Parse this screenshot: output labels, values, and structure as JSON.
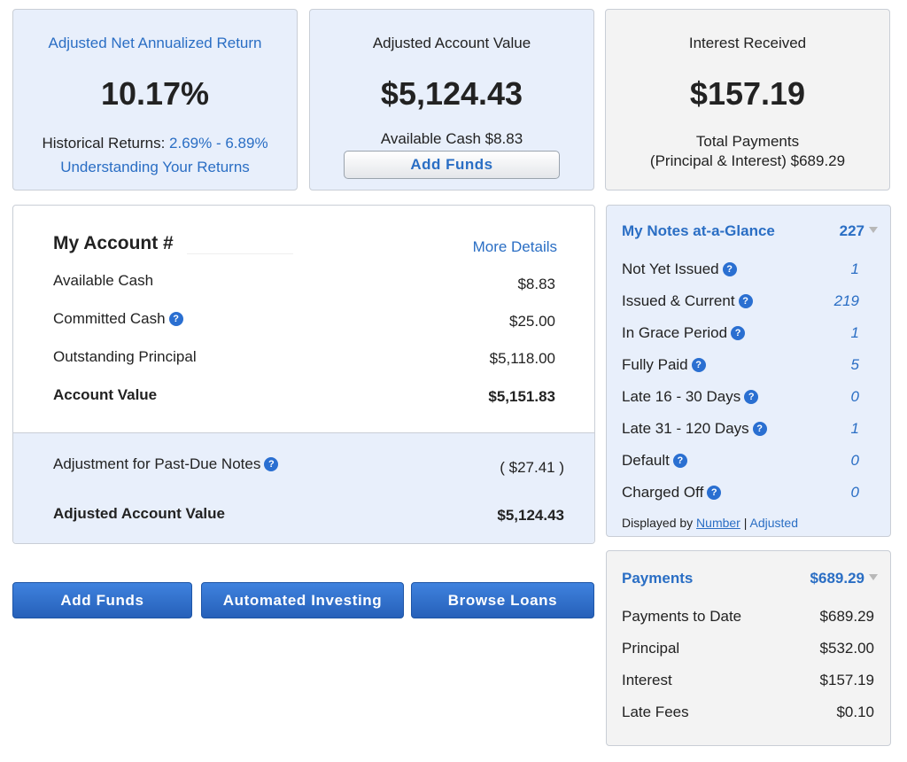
{
  "stat_cards": {
    "return": {
      "label": "Adjusted Net Annualized Return",
      "value": "10.17%",
      "historical_label": "Historical Returns:",
      "historical_range": "2.69% - 6.89%",
      "understanding_link": "Understanding Your Returns"
    },
    "account_value": {
      "label": "Adjusted Account Value",
      "value": "$5,124.43",
      "available_cash": "Available Cash $8.83",
      "add_funds": "Add Funds"
    },
    "interest": {
      "label": "Interest Received",
      "value": "$157.19",
      "total_payments_line1": "Total Payments",
      "total_payments_line2": "(Principal & Interest) $689.29"
    }
  },
  "my_account": {
    "title": "My Account #",
    "more_details": "More Details",
    "rows": [
      {
        "label": "Available Cash",
        "value": "$8.83"
      },
      {
        "label": "Committed Cash",
        "value": "$25.00"
      },
      {
        "label": "Outstanding Principal",
        "value": "$5,118.00"
      },
      {
        "label": "Account Value",
        "value": "$5,151.83"
      }
    ],
    "adjustment_label": "Adjustment for Past-Due Notes",
    "adjustment_value": "( $27.41 )",
    "adjusted_label": "Adjusted Account Value",
    "adjusted_value": "$5,124.43"
  },
  "actions": {
    "add_funds": "Add Funds",
    "automated_investing": "Automated Investing",
    "browse_loans": "Browse Loans"
  },
  "notes_glance": {
    "title": "My Notes at-a-Glance",
    "total": "227",
    "rows": [
      {
        "label": "Not Yet Issued",
        "value": "1"
      },
      {
        "label": "Issued & Current",
        "value": "219"
      },
      {
        "label": "In Grace Period",
        "value": "1"
      },
      {
        "label": "Fully Paid",
        "value": "5"
      },
      {
        "label": "Late 16 - 30 Days",
        "value": "0"
      },
      {
        "label": "Late 31 - 120 Days",
        "value": "1"
      },
      {
        "label": "Default",
        "value": "0"
      },
      {
        "label": "Charged Off",
        "value": "0"
      }
    ],
    "displayed_by": "Displayed by",
    "number_link": "Number",
    "separator": "|",
    "adjusted_link": "Adjusted"
  },
  "payments": {
    "title": "Payments",
    "total": "$689.29",
    "rows": [
      {
        "label": "Payments to Date",
        "value": "$689.29"
      },
      {
        "label": "Principal",
        "value": "$532.00"
      },
      {
        "label": "Interest",
        "value": "$157.19"
      },
      {
        "label": "Late Fees",
        "value": "$0.10"
      }
    ]
  },
  "colors": {
    "link_blue": "#2a6ec4",
    "card_blue": "#e8effb",
    "card_grey": "#f3f3f3",
    "button_blue": "#2f6fcc"
  },
  "icons": {
    "help": "help-icon",
    "dropdown": "caret-down-icon"
  }
}
